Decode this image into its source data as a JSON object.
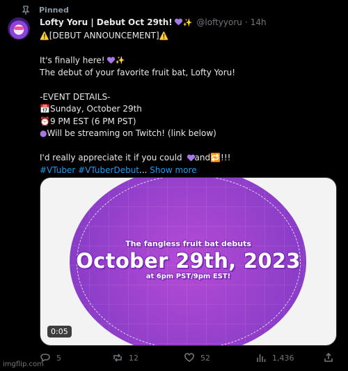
{
  "pinned_label": "Pinned",
  "tweet": {
    "display_name": "Lofty Yoru | Debut Oct 29th!",
    "handle": "@loftyyoru",
    "separator": "·",
    "time": "14h",
    "lines": {
      "announcement": "[DEBUT ANNOUNCEMENT]",
      "line_finally": "It's finally here!",
      "line_debut": "The debut of your favorite fruit bat, Lofty Yoru!",
      "details_heading": "-EVENT DETAILS-",
      "date_line": "Sunday, October 29th",
      "time_line": "9 PM EST (6 PM PST)",
      "stream_line": "Will be streaming on Twitch! (link below)",
      "appreciate_prefix": "I'd really appreciate it if you could ",
      "appreciate_mid": "and",
      "appreciate_suffix": "!!!",
      "hashtag_1": "#VTuber",
      "hashtag_2": "#VTuberDebut",
      "ellipsis": "...",
      "show_more": "Show more"
    }
  },
  "media": {
    "subheading": "The fangless fruit bat debuts",
    "headline": "October 29th, 2023",
    "bottom_text": "at 6pm PST/9pm EST!",
    "duration": "0:05"
  },
  "actions": {
    "replies": "5",
    "reposts": "12",
    "likes": "52",
    "views": "1,436"
  },
  "watermark": "imgflip.com",
  "colors": {
    "background": "#000000",
    "text": "#e7e9ea",
    "muted": "#71767b",
    "link": "#1d9bf0",
    "accent_purple": "#a678e6"
  }
}
